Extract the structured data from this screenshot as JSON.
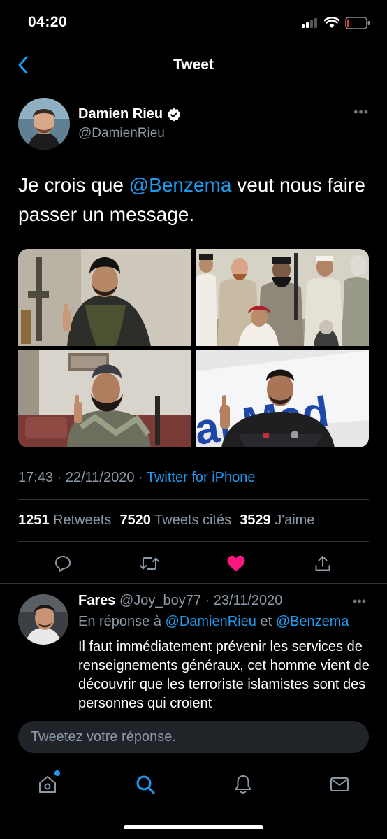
{
  "status_bar": {
    "time": "04:20"
  },
  "nav": {
    "title": "Tweet"
  },
  "tweet": {
    "author_name": "Damien Rieu",
    "author_handle": "@DamienRieu",
    "text_before": "Je crois que ",
    "mention": "@Benzema",
    "text_after": " veut nous faire passer un message.",
    "time": "17:43 · 22/11/2020 · ",
    "source": "Twitter for iPhone",
    "retweets_count": "1251",
    "retweets_label": "Retweets",
    "quotes_count": "7520",
    "quotes_label": "Tweets cités",
    "likes_count": "3529",
    "likes_label": "J'aime",
    "liked": true,
    "like_color": "#f91880",
    "accent_color": "#1d9bf0"
  },
  "reply": {
    "name": "Fares",
    "handle": "@Joy_boy77",
    "date": " · 23/11/2020",
    "reply_prefix": "En réponse à ",
    "reply_mention_1": "@DamienRieu",
    "reply_and": " et ",
    "reply_mention_2": "@Benzema",
    "text": "Il faut immédiatement prévenir les services de renseignements généraux, cet homme vient de découvrir que les terroriste islamistes sont des personnes qui croient"
  },
  "compose": {
    "placeholder": "Tweetez votre réponse."
  },
  "icons": {
    "back": "chevron-left-icon",
    "verified": "verified-badge-icon",
    "more": "more-dots-icon",
    "reply": "comment-icon",
    "retweet": "retweet-icon",
    "like": "heart-icon",
    "share": "share-icon",
    "home": "home-icon",
    "search": "search-icon",
    "notifications": "bell-icon",
    "messages": "mail-icon"
  }
}
